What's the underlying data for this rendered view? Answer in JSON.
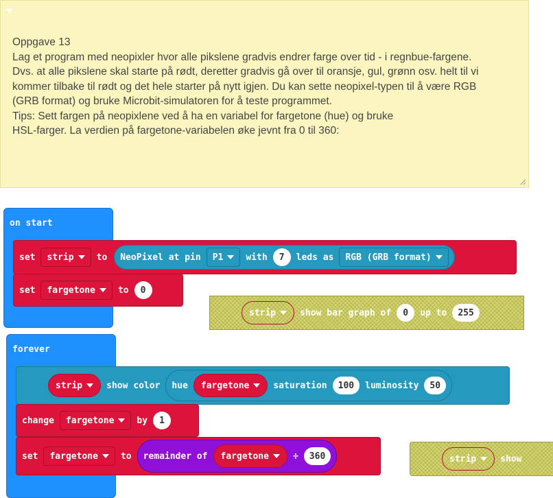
{
  "comment": {
    "lines": [
      "Oppgave 13",
      "Lag et program med neopixler hvor alle pikslene gradvis endrer farge over tid - i regnbue-fargene.",
      "Dvs. at alle pikslene skal starte på rødt, deretter gradvis gå over til oransje, gul, grønn osv. helt til vi",
      "kommer tilbake til rødt og det hele starter på nytt igjen. Du kan sette neopixel-typen til å være RGB",
      "(GRB format) og bruke Microbit-simulatoren for å teste programmet.",
      "Tips: Sett fargen på neopixlene ved å ha en variabel for fargetone (hue) og bruke",
      "HSL-farger. La verdien på fargetone-variabelen øke jevnt fra 0 til 360:"
    ]
  },
  "on_start": {
    "label": "on start",
    "set1": {
      "set": "set",
      "var": "strip",
      "to": "to",
      "neopixel": "NeoPixel at pin",
      "pin": "P1",
      "with": "with",
      "leds": "7",
      "leds_as": "leds as",
      "mode": "RGB (GRB format)"
    },
    "set2": {
      "set": "set",
      "var": "fargetone",
      "to": "to",
      "value": "0"
    }
  },
  "bar_graph": {
    "var": "strip",
    "text1": "show bar graph of",
    "value": "0",
    "upto": "up to",
    "max": "255"
  },
  "forever": {
    "label": "forever",
    "show": {
      "var": "strip",
      "text": "show color",
      "hue": "hue",
      "hue_var": "fargetone",
      "saturation": "saturation",
      "sat_val": "100",
      "luminosity": "luminosity",
      "lum_val": "50"
    },
    "change": {
      "change": "change",
      "var": "fargetone",
      "by": "by",
      "value": "1"
    },
    "set": {
      "set": "set",
      "var": "fargetone",
      "to": "to",
      "remainder": "remainder of",
      "rem_var": "fargetone",
      "div": "÷",
      "divisor": "360"
    }
  },
  "show_fragment": {
    "var": "strip",
    "text": "show"
  },
  "colors": {
    "event": "#1e90ff",
    "variables": "#dc143c",
    "neopixel": "#2699bf",
    "math": "#8f10d8",
    "comment_bg": "#fbf6bf"
  }
}
